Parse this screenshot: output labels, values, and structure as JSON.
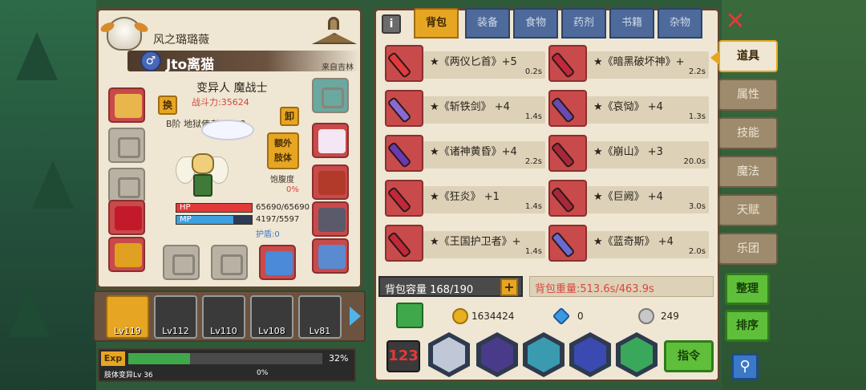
{
  "character": {
    "guild_name": "风之璐璐薇",
    "player_name": "Jto离猫",
    "origin": "来自吉林",
    "class_name": "变异人 魔战士",
    "power": "战斗力:35624",
    "rank_line": "B阶 地狱使者 Lv 52",
    "swap_label": "换",
    "unload_label": "卸",
    "extra_label_1": "额外",
    "extra_label_2": "肢体",
    "satiety_label": "饱腹度",
    "satiety_value": "0%",
    "hp_label": "HP",
    "hp_value": "65690/65690",
    "mp_label": "MP",
    "mp_value": "4197/5597",
    "mp_ratio": 0.75,
    "shield": "护盾:0"
  },
  "team": [
    {
      "level": "Lv119",
      "active": true
    },
    {
      "level": "Lv112",
      "active": false
    },
    {
      "level": "Lv110",
      "active": false
    },
    {
      "level": "Lv108",
      "active": false
    },
    {
      "level": "Lv81",
      "active": false
    }
  ],
  "exp": {
    "label": "Exp",
    "percent": "32%",
    "fill_ratio": 0.32,
    "body_change": "肢体变异Lv 36",
    "body_percent": "0%"
  },
  "tabs": [
    "背包",
    "装备",
    "食物",
    "药剂",
    "书籍",
    "杂物"
  ],
  "items": [
    {
      "name": "★《两仪匕首》+5",
      "weight": "0.2s",
      "color": "#e23a3a"
    },
    {
      "name": "★《暗黑破坏神》+",
      "weight": "2.2s",
      "color": "#c2283a"
    },
    {
      "name": "★《斩铁剑》 +4",
      "weight": "1.4s",
      "color": "#8a6ad0"
    },
    {
      "name": "★《哀恸》 +4",
      "weight": "1.3s",
      "color": "#6a4ab0"
    },
    {
      "name": "★《诸神黄昏》+4",
      "weight": "2.2s",
      "color": "#6a3ab0"
    },
    {
      "name": "★《崩山》 +3",
      "weight": "20.0s",
      "color": "#a8283a"
    },
    {
      "name": "★《狂炎》 +1",
      "weight": "1.4s",
      "color": "#c2283a"
    },
    {
      "name": "★《巨阙》 +4",
      "weight": "3.0s",
      "color": "#a8283a"
    },
    {
      "name": "★《王国护卫者》+",
      "weight": "1.4s",
      "color": "#c2283a"
    },
    {
      "name": "★《蓝奇斯》 +4",
      "weight": "2.0s",
      "color": "#6a6ad0"
    }
  ],
  "inventory": {
    "capacity": "背包容量 168/190",
    "weight": "背包重量:513.6s/463.9s",
    "gold": "1634424",
    "gems": "0",
    "silver": "249",
    "order_label": "123",
    "command_label": "指令"
  },
  "side_nav": [
    "道具",
    "属性",
    "技能",
    "魔法",
    "天赋",
    "乐团"
  ],
  "side_buttons": {
    "organize": "整理",
    "sort": "排序"
  },
  "colors": {
    "accent": "#e6a623",
    "panel": "#efe6d3",
    "tab_blue": "#4d6a9a",
    "hp": "#e23a3a",
    "mp": "#3fa0e0",
    "green_button": "#5fbf3a"
  }
}
